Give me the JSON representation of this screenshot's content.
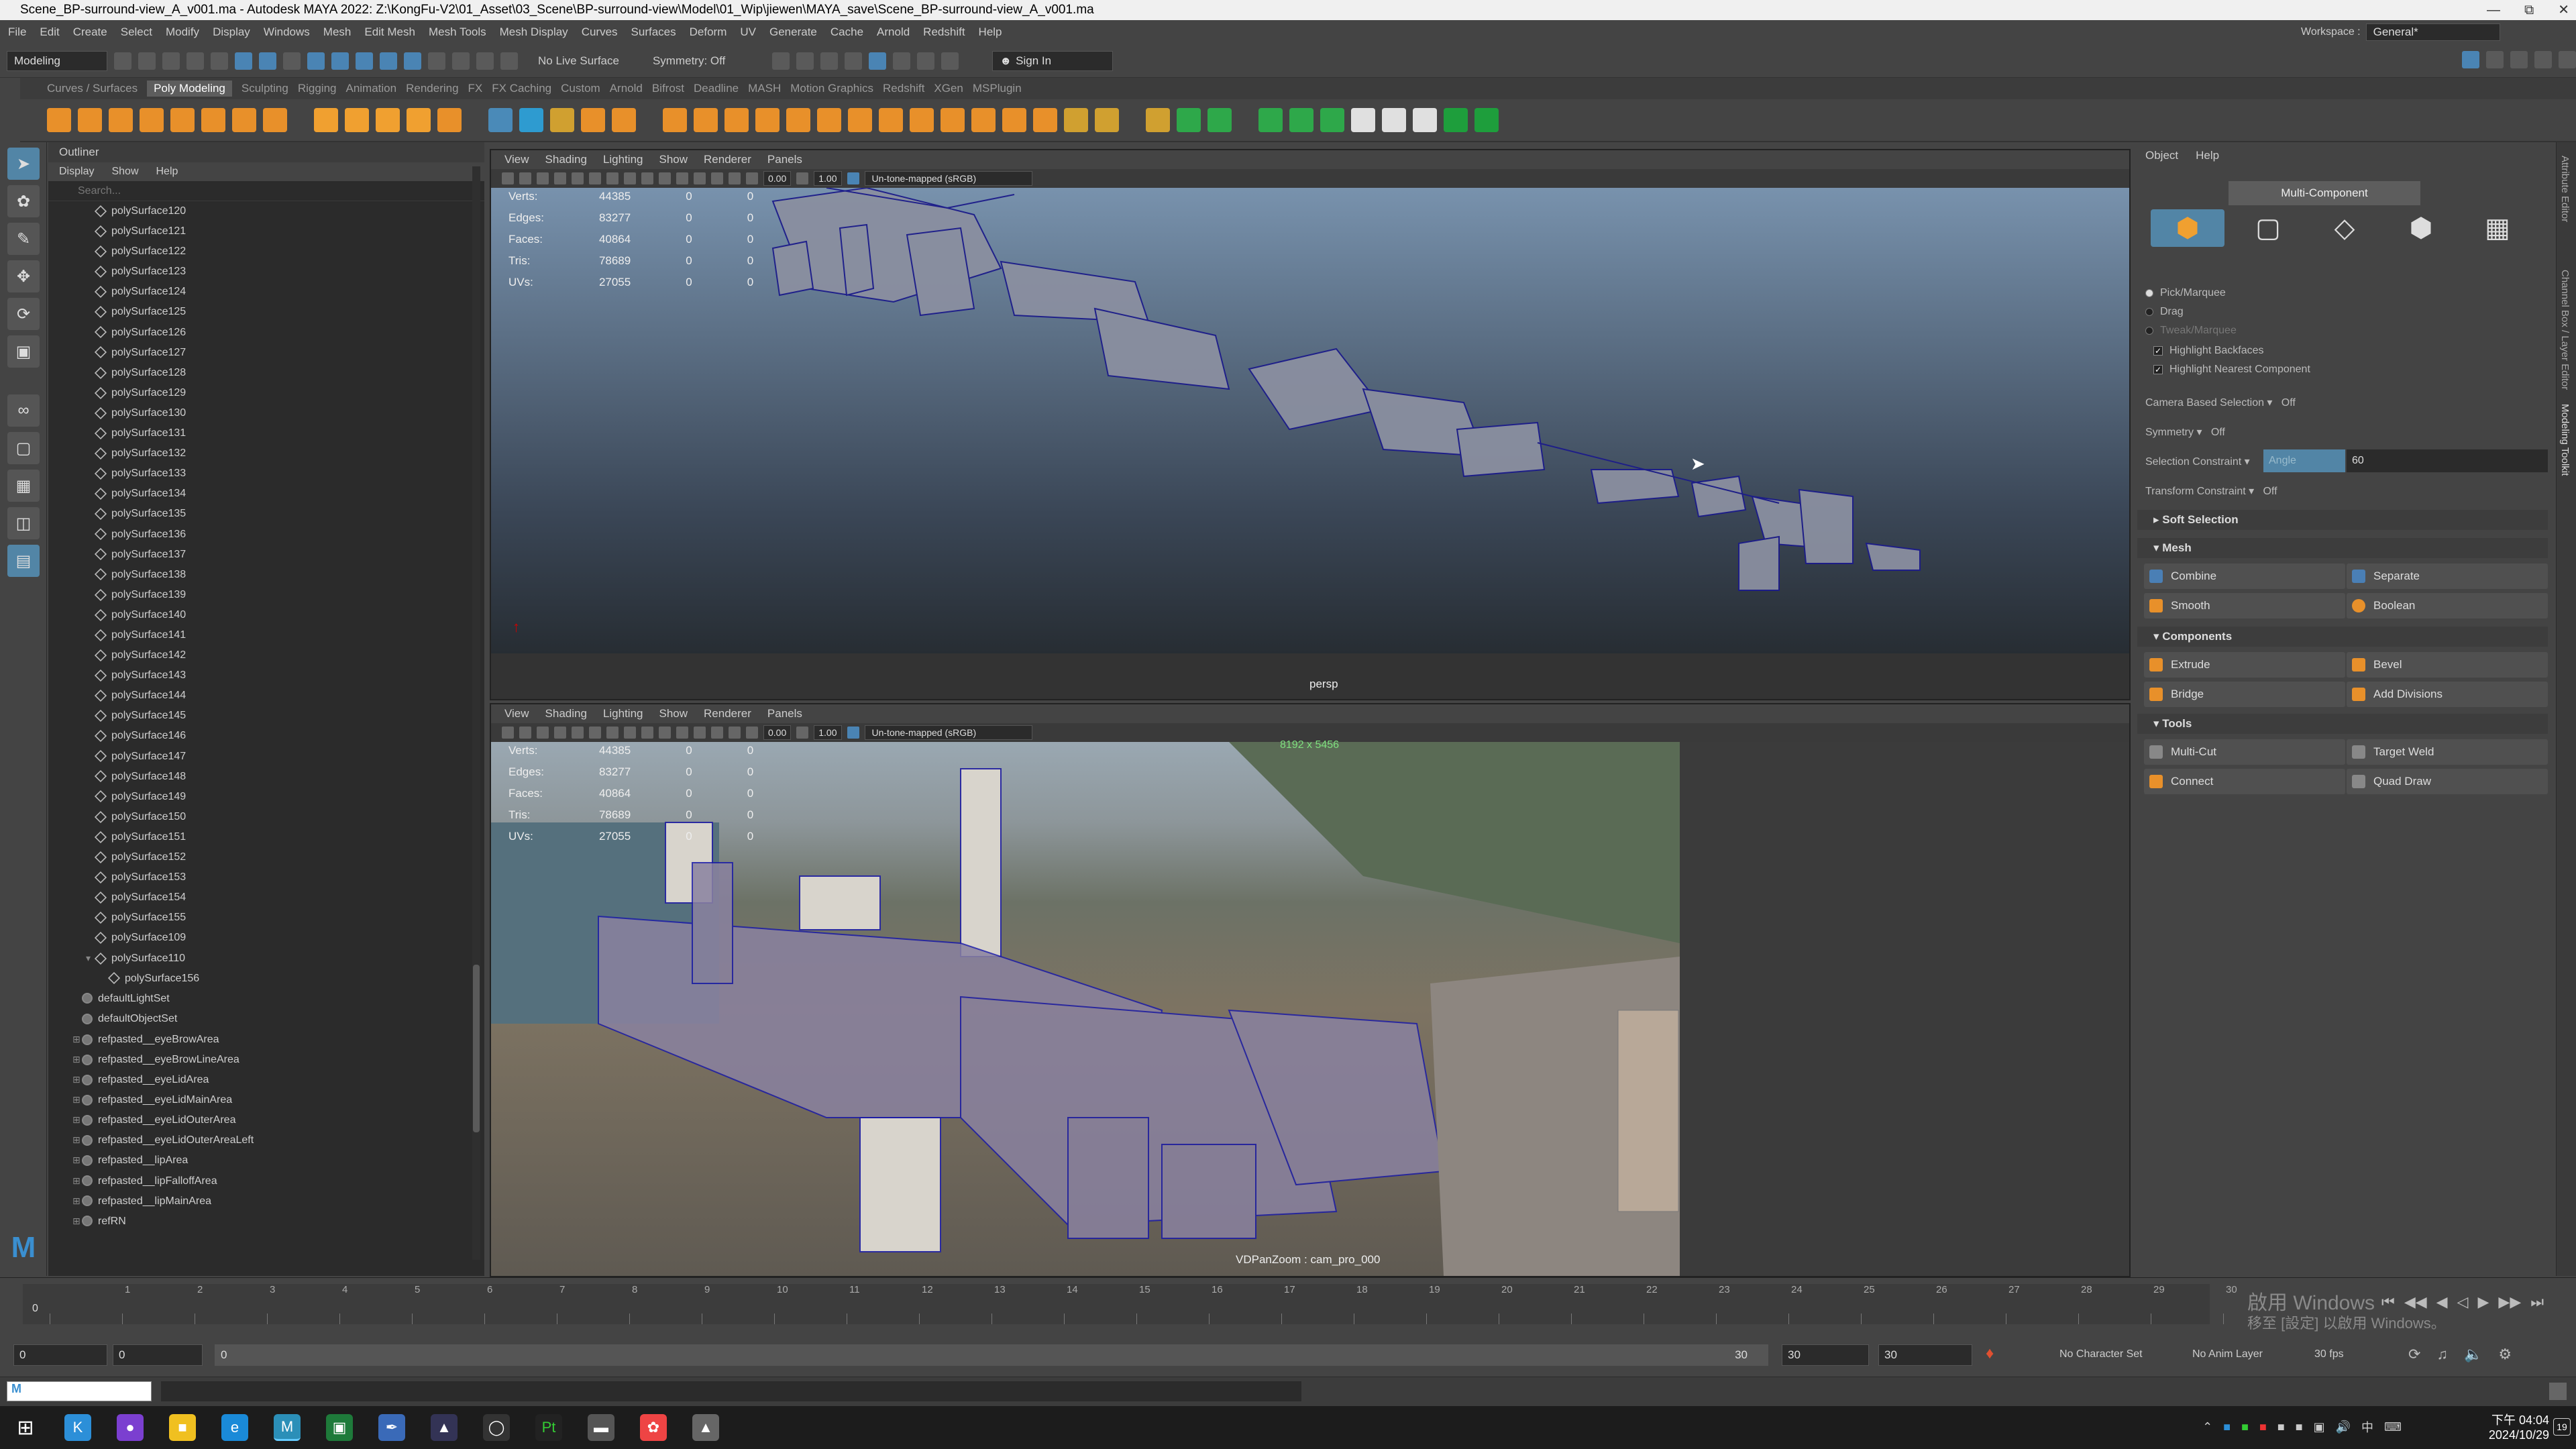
{
  "window": {
    "title": "Scene_BP-surround-view_A_v001.ma - Autodesk MAYA 2022: Z:\\KongFu-V2\\01_Asset\\03_Scene\\BP-surround-view\\Model\\01_Wip\\jiewen\\MAYA_save\\Scene_BP-surround-view_A_v001.ma"
  },
  "menubar": [
    "File",
    "Edit",
    "Create",
    "Select",
    "Modify",
    "Display",
    "Windows",
    "Mesh",
    "Edit Mesh",
    "Mesh Tools",
    "Mesh Display",
    "Curves",
    "Surfaces",
    "Deform",
    "UV",
    "Generate",
    "Cache",
    "Arnold",
    "Redshift",
    "Help"
  ],
  "workspace": {
    "label": "Workspace :",
    "value": "General*"
  },
  "statusline": {
    "mode": "Modeling",
    "live_surface": "No Live Surface",
    "symmetry": "Symmetry: Off",
    "sign_in": "Sign In"
  },
  "shelf_tabs": [
    "Curves / Surfaces",
    "Poly Modeling",
    "Sculpting",
    "Rigging",
    "Animation",
    "Rendering",
    "FX",
    "FX Caching",
    "Custom",
    "Arnold",
    "Bifrost",
    "Deadline",
    "MASH",
    "Motion Graphics",
    "Redshift",
    "XGen",
    "MSPlugin"
  ],
  "shelf_icon_colors": [
    "#e8902a",
    "#e8902a",
    "#e8902a",
    "#e8902a",
    "#e8902a",
    "#e8902a",
    "#e8902a",
    "#e8902a",
    "#f0a030",
    "#f0a030",
    "#f0a030",
    "#f0a030",
    "#e8902a",
    "#4a8ab8",
    "#2e9bd0",
    "#d0a030",
    "#e8902a",
    "#e8902a",
    "#e8902a",
    "#e8902a",
    "#e8902a",
    "#e8902a",
    "#e8902a",
    "#e8902a",
    "#e8902a",
    "#e8902a",
    "#e8902a",
    "#e8902a",
    "#e8902a",
    "#e8902a",
    "#e8902a",
    "#d0a030",
    "#d0a030",
    "#d0a030",
    "#2ea84a",
    "#2ea84a",
    "#2ea84a",
    "#2ea84a",
    "#2ea84a",
    "#e0e0e0",
    "#e0e0e0",
    "#e0e0e0",
    "#1e9e3c",
    "#1e9e3c"
  ],
  "outliner": {
    "title": "Outliner",
    "menu": [
      "Display",
      "Show",
      "Help"
    ],
    "search_placeholder": "Search...",
    "items": [
      {
        "name": "polySurface120",
        "type": "mesh",
        "indent": 1
      },
      {
        "name": "polySurface121",
        "type": "mesh",
        "indent": 1
      },
      {
        "name": "polySurface122",
        "type": "mesh",
        "indent": 1
      },
      {
        "name": "polySurface123",
        "type": "mesh",
        "indent": 1
      },
      {
        "name": "polySurface124",
        "type": "mesh",
        "indent": 1
      },
      {
        "name": "polySurface125",
        "type": "mesh",
        "indent": 1
      },
      {
        "name": "polySurface126",
        "type": "mesh",
        "indent": 1
      },
      {
        "name": "polySurface127",
        "type": "mesh",
        "indent": 1
      },
      {
        "name": "polySurface128",
        "type": "mesh",
        "indent": 1
      },
      {
        "name": "polySurface129",
        "type": "mesh",
        "indent": 1
      },
      {
        "name": "polySurface130",
        "type": "mesh",
        "indent": 1
      },
      {
        "name": "polySurface131",
        "type": "mesh",
        "indent": 1
      },
      {
        "name": "polySurface132",
        "type": "mesh",
        "indent": 1
      },
      {
        "name": "polySurface133",
        "type": "mesh",
        "indent": 1
      },
      {
        "name": "polySurface134",
        "type": "mesh",
        "indent": 1
      },
      {
        "name": "polySurface135",
        "type": "mesh",
        "indent": 1
      },
      {
        "name": "polySurface136",
        "type": "mesh",
        "indent": 1
      },
      {
        "name": "polySurface137",
        "type": "mesh",
        "indent": 1
      },
      {
        "name": "polySurface138",
        "type": "mesh",
        "indent": 1
      },
      {
        "name": "polySurface139",
        "type": "mesh",
        "indent": 1
      },
      {
        "name": "polySurface140",
        "type": "mesh",
        "indent": 1
      },
      {
        "name": "polySurface141",
        "type": "mesh",
        "indent": 1
      },
      {
        "name": "polySurface142",
        "type": "mesh",
        "indent": 1
      },
      {
        "name": "polySurface143",
        "type": "mesh",
        "indent": 1
      },
      {
        "name": "polySurface144",
        "type": "mesh",
        "indent": 1
      },
      {
        "name": "polySurface145",
        "type": "mesh",
        "indent": 1
      },
      {
        "name": "polySurface146",
        "type": "mesh",
        "indent": 1
      },
      {
        "name": "polySurface147",
        "type": "mesh",
        "indent": 1
      },
      {
        "name": "polySurface148",
        "type": "mesh",
        "indent": 1
      },
      {
        "name": "polySurface149",
        "type": "mesh",
        "indent": 1
      },
      {
        "name": "polySurface150",
        "type": "mesh",
        "indent": 1
      },
      {
        "name": "polySurface151",
        "type": "mesh",
        "indent": 1
      },
      {
        "name": "polySurface152",
        "type": "mesh",
        "indent": 1
      },
      {
        "name": "polySurface153",
        "type": "mesh",
        "indent": 1
      },
      {
        "name": "polySurface154",
        "type": "mesh",
        "indent": 1
      },
      {
        "name": "polySurface155",
        "type": "mesh",
        "indent": 1
      },
      {
        "name": "polySurface109",
        "type": "mesh",
        "indent": 1
      },
      {
        "name": "polySurface110",
        "type": "group",
        "indent": 1
      },
      {
        "name": "polySurface156",
        "type": "mesh",
        "indent": 2
      },
      {
        "name": "defaultLightSet",
        "type": "set",
        "indent": 0
      },
      {
        "name": "defaultObjectSet",
        "type": "set",
        "indent": 0
      },
      {
        "name": "refpasted__eyeBrowArea",
        "type": "set",
        "indent": 0
      },
      {
        "name": "refpasted__eyeBrowLineArea",
        "type": "set",
        "indent": 0
      },
      {
        "name": "refpasted__eyeLidArea",
        "type": "set",
        "indent": 0
      },
      {
        "name": "refpasted__eyeLidMainArea",
        "type": "set",
        "indent": 0
      },
      {
        "name": "refpasted__eyeLidOuterArea",
        "type": "set",
        "indent": 0
      },
      {
        "name": "refpasted__eyeLidOuterAreaLeft",
        "type": "set",
        "indent": 0
      },
      {
        "name": "refpasted__lipArea",
        "type": "set",
        "indent": 0
      },
      {
        "name": "refpasted__lipFalloffArea",
        "type": "set",
        "indent": 0
      },
      {
        "name": "refpasted__lipMainArea",
        "type": "set",
        "indent": 0
      },
      {
        "name": "refRN",
        "type": "ref",
        "indent": 0
      }
    ]
  },
  "viewport_menu": [
    "View",
    "Shading",
    "Lighting",
    "Show",
    "Renderer",
    "Panels"
  ],
  "viewport_toolbar": {
    "value1": "0.00",
    "value2": "1.00",
    "colorspace": "Un-tone-mapped (sRGB)"
  },
  "hud": {
    "labels": [
      "Verts:",
      "Edges:",
      "Faces:",
      "Tris:",
      "UVs:"
    ],
    "values": [
      "44385",
      "83277",
      "40864",
      "78689",
      "27055"
    ],
    "zero1": "0",
    "zero2": "0"
  },
  "viewport1": {
    "camera_label": "persp"
  },
  "viewport2": {
    "resolution": "8192 x 5456",
    "camera_label": "VDPanZoom : cam_pro_000"
  },
  "modeling_toolkit": {
    "menu": [
      "Object",
      "Help"
    ],
    "mode_label": "Multi-Component",
    "pick_marquee": "Pick/Marquee",
    "drag": "Drag",
    "tweak_marquee": "Tweak/Marquee",
    "highlight_backfaces": "Highlight Backfaces",
    "highlight_nearest": "Highlight Nearest Component",
    "camera_based_selection": "Camera Based Selection",
    "camera_based_value": "Off",
    "symmetry_label": "Symmetry",
    "symmetry_value": "Off",
    "selection_constraint": "Selection Constraint",
    "constraint_type": "Angle",
    "constraint_value": "60",
    "transform_constraint": "Transform Constraint",
    "transform_value": "Off",
    "sections": {
      "soft_selection": "Soft Selection",
      "mesh": "Mesh",
      "components": "Components",
      "tools": "Tools"
    },
    "mesh_buttons": [
      "Combine",
      "Separate",
      "Smooth",
      "Boolean"
    ],
    "component_buttons": [
      "Extrude",
      "Bevel",
      "Bridge",
      "Add Divisions"
    ],
    "tool_buttons": [
      "Multi-Cut",
      "Target Weld",
      "Connect",
      "Quad Draw"
    ]
  },
  "right_tabs": [
    "Attribute Editor",
    "Channel Box / Layer Editor",
    "Modeling Toolkit"
  ],
  "timeline": {
    "ticks": [
      "0",
      "1",
      "2",
      "3",
      "4",
      "5",
      "6",
      "7",
      "8",
      "9",
      "10",
      "11",
      "12",
      "13",
      "14",
      "15",
      "16",
      "17",
      "18",
      "19",
      "20",
      "21",
      "22",
      "23",
      "24",
      "25",
      "26",
      "27",
      "28",
      "29",
      "30"
    ],
    "current_frame": "0"
  },
  "range": {
    "start": "0",
    "inner_start": "0",
    "slider_start": "0",
    "slider_end": "30",
    "end": "30",
    "outer_end": "30",
    "char_set": "No Character Set",
    "anim_layer": "No Anim Layer",
    "fps": "30 fps"
  },
  "watermark": {
    "line1": "啟用 Windows",
    "line2": "移至 [設定] 以啟用 Windows。"
  },
  "clock": {
    "time": "下午 04:04",
    "date": "2024/10/29"
  },
  "notification_count": "19"
}
